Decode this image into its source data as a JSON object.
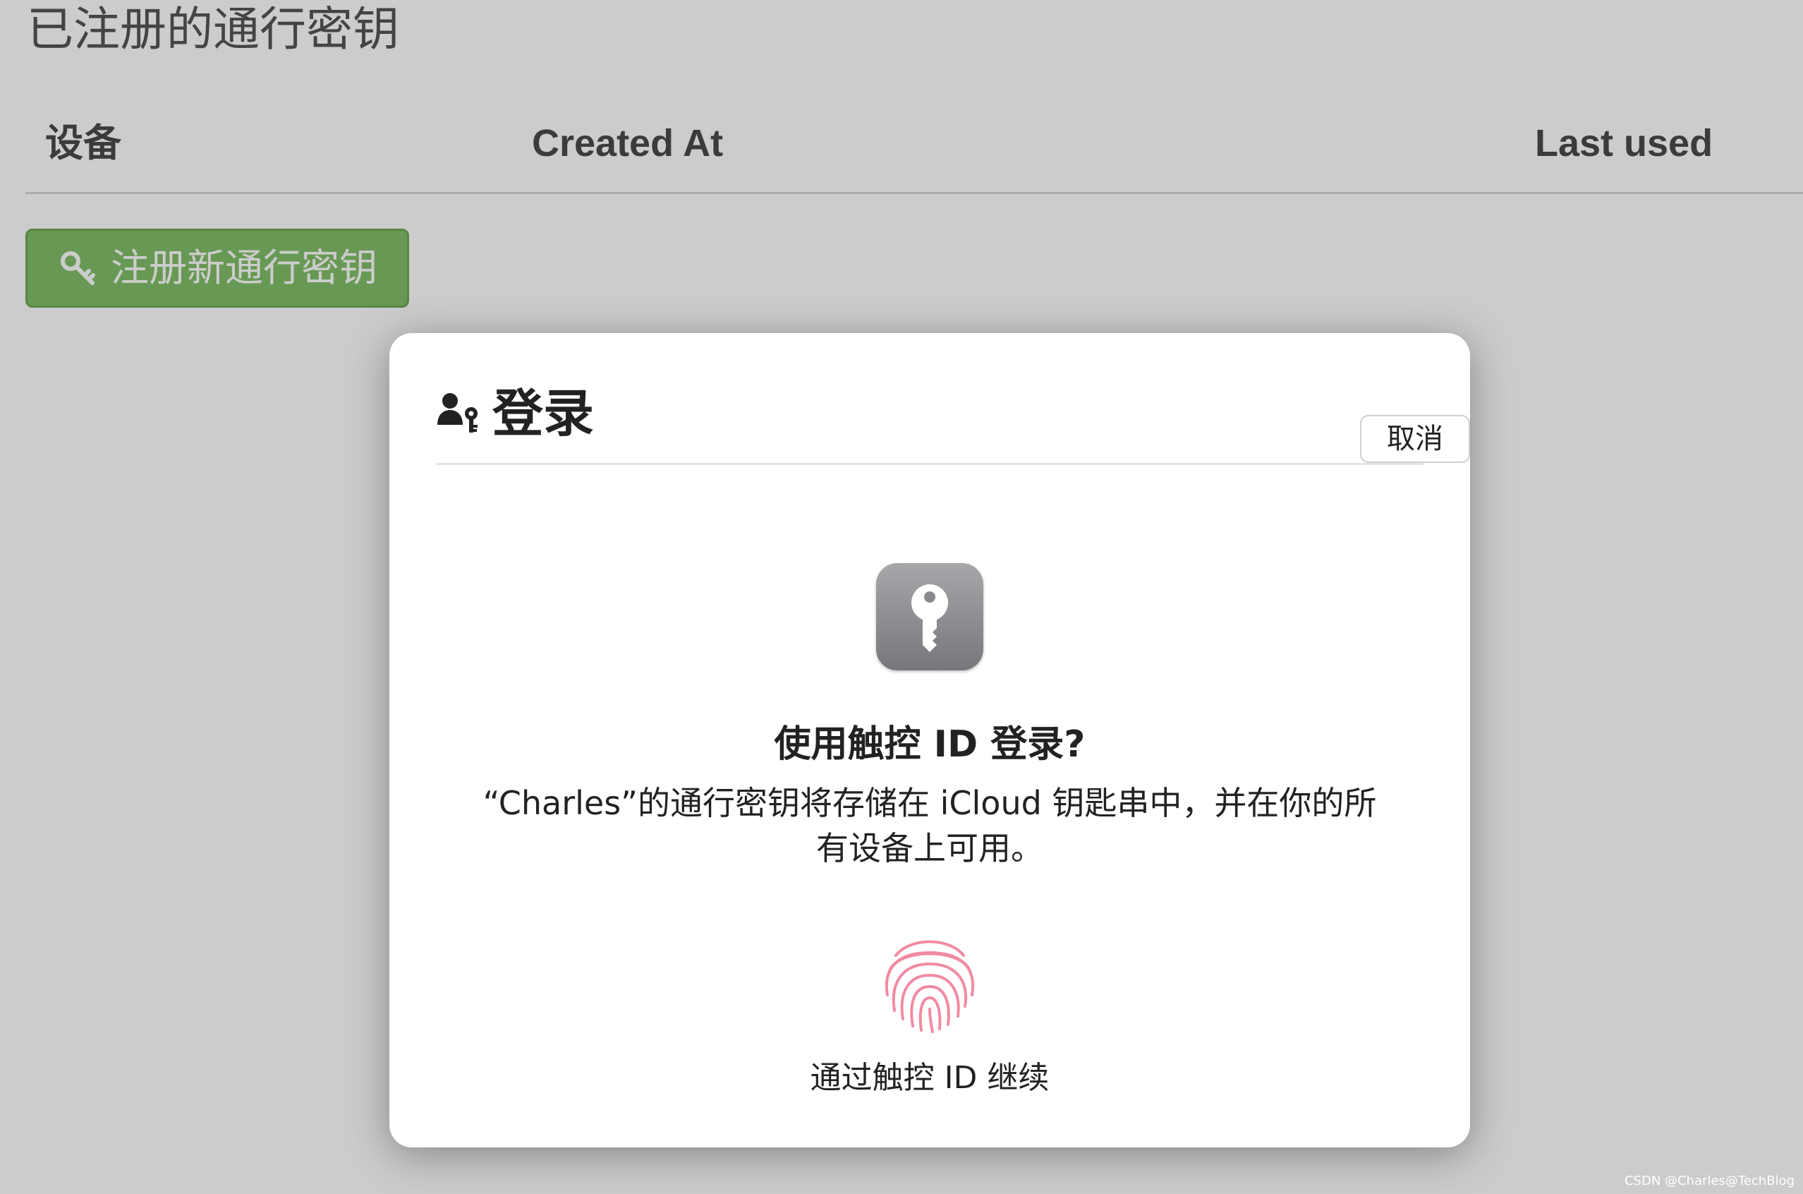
{
  "page": {
    "title": "已注册的通行密钥",
    "table_headers": [
      "设备",
      "Created At",
      "Last used"
    ],
    "register_button_label": "注册新通行密钥"
  },
  "modal": {
    "title": "登录",
    "cancel_label": "取消",
    "prompt_title": "使用触控 ID 登录?",
    "prompt_message": "“Charles”的通行密钥将存储在 iCloud 钥匙串中，并在你的所有设备上可用。",
    "continue_label": "通过触控 ID 继续"
  },
  "icons": {
    "header": "user-key-icon",
    "register": "key-icon",
    "app": "passwords-key-app-icon",
    "biometric": "fingerprint-icon"
  },
  "colors": {
    "register_button": "#82c06a",
    "fingerprint": "#f28aa3",
    "overlay": "rgba(0,0,0,0.20)"
  },
  "watermark": "CSDN @Charles@TechBlog"
}
